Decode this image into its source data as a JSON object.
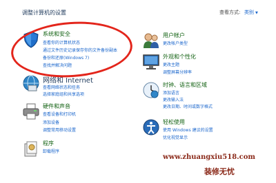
{
  "header": {
    "page_title": "调整计算机的设置",
    "view_by_label": "查看方式:",
    "view_mode": "类别"
  },
  "left_categories": [
    {
      "title": "系统和安全",
      "icon": "shield-icon",
      "links": [
        "查看你的计算机状态",
        "通过文件历史记录保存你的文件备份副本",
        "备份和还原(Windows 7)",
        "查找并解决问题"
      ]
    },
    {
      "title": "网络和 Internet",
      "icon": "network-icon",
      "links": [
        "查看网络状态和任务",
        "选择家庭组和共享选项"
      ]
    },
    {
      "title": "硬件和声音",
      "icon": "printer-icon",
      "links": [
        "查看设备和打印机",
        "添加设备",
        "调整常用移动设置"
      ]
    },
    {
      "title": "程序",
      "icon": "programs-icon",
      "links": [
        "卸载程序"
      ]
    }
  ],
  "right_categories": [
    {
      "title": "用户帐户",
      "icon": "users-icon",
      "links": [
        "更改帐户类型"
      ]
    },
    {
      "title": "外观和个性化",
      "icon": "monitor-icon",
      "links": [
        "更改主题",
        "调整屏幕分辨率"
      ]
    },
    {
      "title": "时钟、语言和区域",
      "icon": "clock-globe-icon",
      "links": [
        "添加语言",
        "更改输入法",
        "更改日期、时间或数字格式"
      ]
    },
    {
      "title": "轻松使用",
      "icon": "ease-of-access-icon",
      "links": [
        "使用 Windows 建议的设置",
        "优化视觉显示"
      ]
    }
  ],
  "watermark": {
    "url": "www.zhuangxiu518.com",
    "name": "装修无忧"
  }
}
